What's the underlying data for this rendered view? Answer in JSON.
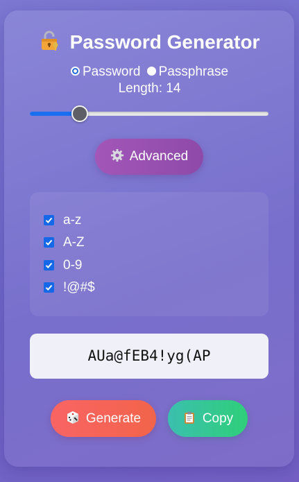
{
  "app": {
    "title": "Password Generator"
  },
  "mode": {
    "options": [
      {
        "label": "Password",
        "selected": true
      },
      {
        "label": "Passphrase",
        "selected": false
      }
    ]
  },
  "length": {
    "label": "Length: 14",
    "value": 14,
    "slider_fraction": 0.21
  },
  "advanced": {
    "label": "Advanced",
    "icon": "gear-icon"
  },
  "charsets": [
    {
      "label": "a-z",
      "checked": true
    },
    {
      "label": "A-Z",
      "checked": true
    },
    {
      "label": "0-9",
      "checked": true
    },
    {
      "label": "!@#$",
      "checked": true
    }
  ],
  "output": {
    "password": "AUa@fEB4!yg(AP"
  },
  "actions": {
    "generate_label": "Generate",
    "generate_icon": "dice-icon",
    "copy_label": "Copy",
    "copy_icon": "clipboard-icon"
  },
  "colors": {
    "accent_blue": "#1a6ff0",
    "advanced_purple": "#9b51b3",
    "generate_red": "#f6644f",
    "copy_green": "#34c88f"
  }
}
